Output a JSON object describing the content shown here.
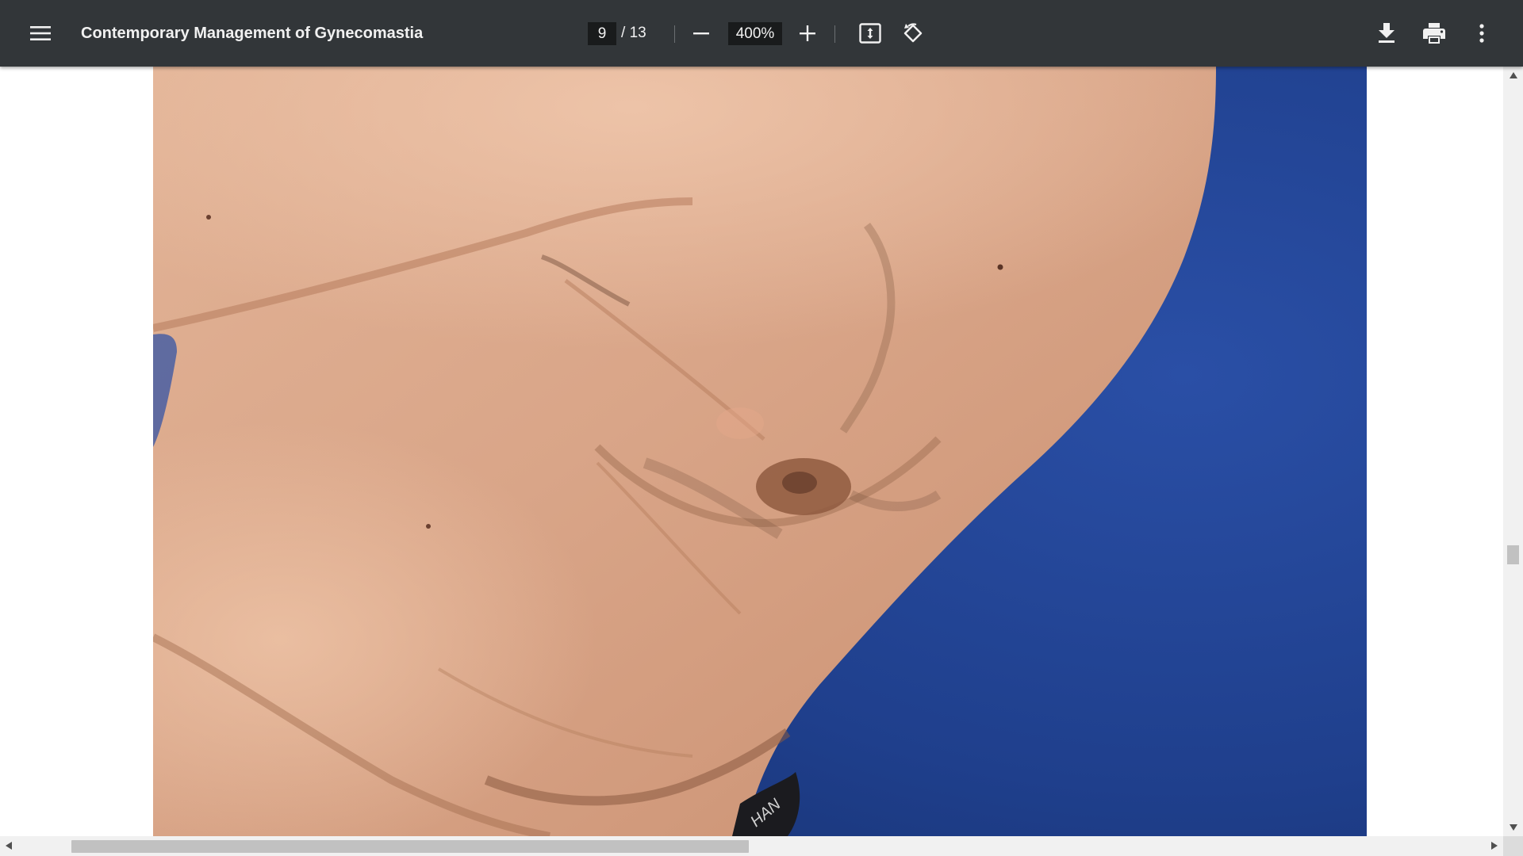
{
  "toolbar": {
    "title": "Contemporary Management of Gynecomastia",
    "current_page": "9",
    "page_separator": "/",
    "total_pages": "13",
    "zoom_value": "400%",
    "icons": {
      "menu": "menu-icon",
      "zoom_out": "minus-icon",
      "zoom_in": "plus-icon",
      "fit": "fit-to-page-icon",
      "rotate": "rotate-counterclockwise-icon",
      "download": "download-icon",
      "print": "print-icon",
      "more": "more-vertical-icon"
    }
  },
  "viewer": {
    "image_watermark": "HAN",
    "colors": {
      "toolbar_bg": "#323639",
      "backdrop": "#1f3f8c",
      "skin": "#d9a588",
      "scrollbar_track": "#f1f1f1",
      "scrollbar_thumb": "#c1c1c1"
    }
  }
}
